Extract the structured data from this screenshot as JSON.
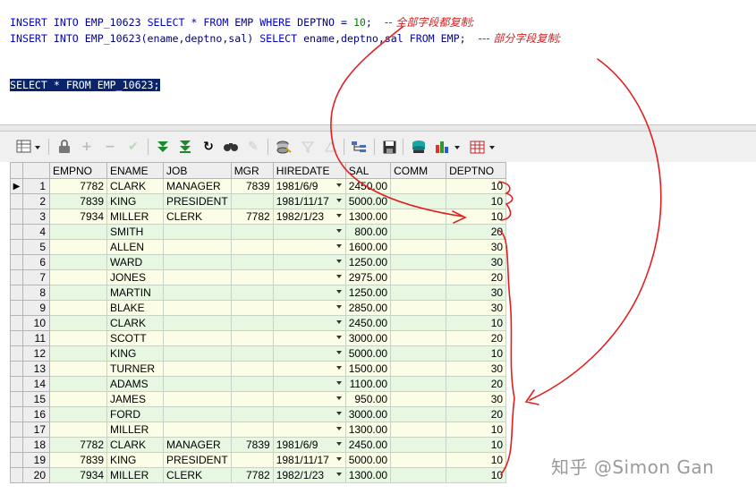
{
  "editor": {
    "line1": {
      "kw1": "INSERT INTO",
      "obj1": " EMP_10623 ",
      "kw2": "SELECT",
      "mid": " * ",
      "kw3": "FROM",
      "obj2": " EMP ",
      "kw4": "WHERE",
      "obj3": " DEPTNO = ",
      "num": "10",
      "tail": ";",
      "comment": "-- 全部字段都复制;"
    },
    "line2": {
      "kw1": "INSERT INTO",
      "obj1": " EMP_10623(ename,deptno,sal) ",
      "kw2": "SELECT",
      "obj2": " ename,deptno,sal ",
      "kw3": "FROM",
      "obj3": " EMP;",
      "comment": "--- 部分字段复制;"
    },
    "line3": {
      "text": "SELECT * FROM EMP_10623;"
    }
  },
  "toolbar": {
    "icons": [
      "grid-menu-icon",
      "lock-icon",
      "add-record-icon",
      "delete-record-icon",
      "post-check-icon",
      "fetch-next-icon",
      "fetch-last-icon",
      "refresh-icon",
      "find-icon",
      "clear-icon",
      "query-by-example-icon",
      "filter-icon",
      "clear-filter-icon",
      "explain-plan-icon",
      "save-icon",
      "export-icon",
      "chart-icon",
      "grid-view-icon"
    ]
  },
  "grid": {
    "columns": [
      "EMPNO",
      "ENAME",
      "JOB",
      "MGR",
      "HIREDATE",
      "SAL",
      "COMM",
      "DEPTNO"
    ],
    "rows": [
      {
        "n": "1",
        "empno": "7782",
        "ename": "CLARK",
        "job": "MANAGER",
        "mgr": "7839",
        "hiredate": "1981/6/9",
        "sal": "2450.00",
        "comm": "",
        "deptno": "10",
        "style": "y",
        "current": true
      },
      {
        "n": "2",
        "empno": "7839",
        "ename": "KING",
        "job": "PRESIDENT",
        "mgr": "",
        "hiredate": "1981/11/17",
        "sal": "5000.00",
        "comm": "",
        "deptno": "10",
        "style": "g"
      },
      {
        "n": "3",
        "empno": "7934",
        "ename": "MILLER",
        "job": "CLERK",
        "mgr": "7782",
        "hiredate": "1982/1/23",
        "sal": "1300.00",
        "comm": "",
        "deptno": "10",
        "style": "y"
      },
      {
        "n": "4",
        "empno": "",
        "ename": "SMITH",
        "job": "",
        "mgr": "",
        "hiredate": "",
        "sal": "800.00",
        "comm": "",
        "deptno": "20",
        "style": "g"
      },
      {
        "n": "5",
        "empno": "",
        "ename": "ALLEN",
        "job": "",
        "mgr": "",
        "hiredate": "",
        "sal": "1600.00",
        "comm": "",
        "deptno": "30",
        "style": "y"
      },
      {
        "n": "6",
        "empno": "",
        "ename": "WARD",
        "job": "",
        "mgr": "",
        "hiredate": "",
        "sal": "1250.00",
        "comm": "",
        "deptno": "30",
        "style": "g"
      },
      {
        "n": "7",
        "empno": "",
        "ename": "JONES",
        "job": "",
        "mgr": "",
        "hiredate": "",
        "sal": "2975.00",
        "comm": "",
        "deptno": "20",
        "style": "y"
      },
      {
        "n": "8",
        "empno": "",
        "ename": "MARTIN",
        "job": "",
        "mgr": "",
        "hiredate": "",
        "sal": "1250.00",
        "comm": "",
        "deptno": "30",
        "style": "g"
      },
      {
        "n": "9",
        "empno": "",
        "ename": "BLAKE",
        "job": "",
        "mgr": "",
        "hiredate": "",
        "sal": "2850.00",
        "comm": "",
        "deptno": "30",
        "style": "y"
      },
      {
        "n": "10",
        "empno": "",
        "ename": "CLARK",
        "job": "",
        "mgr": "",
        "hiredate": "",
        "sal": "2450.00",
        "comm": "",
        "deptno": "10",
        "style": "g"
      },
      {
        "n": "11",
        "empno": "",
        "ename": "SCOTT",
        "job": "",
        "mgr": "",
        "hiredate": "",
        "sal": "3000.00",
        "comm": "",
        "deptno": "20",
        "style": "y"
      },
      {
        "n": "12",
        "empno": "",
        "ename": "KING",
        "job": "",
        "mgr": "",
        "hiredate": "",
        "sal": "5000.00",
        "comm": "",
        "deptno": "10",
        "style": "g"
      },
      {
        "n": "13",
        "empno": "",
        "ename": "TURNER",
        "job": "",
        "mgr": "",
        "hiredate": "",
        "sal": "1500.00",
        "comm": "",
        "deptno": "30",
        "style": "y"
      },
      {
        "n": "14",
        "empno": "",
        "ename": "ADAMS",
        "job": "",
        "mgr": "",
        "hiredate": "",
        "sal": "1100.00",
        "comm": "",
        "deptno": "20",
        "style": "g"
      },
      {
        "n": "15",
        "empno": "",
        "ename": "JAMES",
        "job": "",
        "mgr": "",
        "hiredate": "",
        "sal": "950.00",
        "comm": "",
        "deptno": "30",
        "style": "y"
      },
      {
        "n": "16",
        "empno": "",
        "ename": "FORD",
        "job": "",
        "mgr": "",
        "hiredate": "",
        "sal": "3000.00",
        "comm": "",
        "deptno": "20",
        "style": "g"
      },
      {
        "n": "17",
        "empno": "",
        "ename": "MILLER",
        "job": "",
        "mgr": "",
        "hiredate": "",
        "sal": "1300.00",
        "comm": "",
        "deptno": "10",
        "style": "y"
      },
      {
        "n": "18",
        "empno": "7782",
        "ename": "CLARK",
        "job": "MANAGER",
        "mgr": "7839",
        "hiredate": "1981/6/9",
        "sal": "2450.00",
        "comm": "",
        "deptno": "10",
        "style": "g"
      },
      {
        "n": "19",
        "empno": "7839",
        "ename": "KING",
        "job": "PRESIDENT",
        "mgr": "",
        "hiredate": "1981/11/17",
        "sal": "5000.00",
        "comm": "",
        "deptno": "10",
        "style": "y"
      },
      {
        "n": "20",
        "empno": "7934",
        "ename": "MILLER",
        "job": "CLERK",
        "mgr": "7782",
        "hiredate": "1982/1/23",
        "sal": "1300.00",
        "comm": "",
        "deptno": "10",
        "style": "g"
      }
    ]
  },
  "watermark": "知乎 @Simon Gan",
  "colors": {
    "annotation": "#e02020",
    "keyword": "#0000cc",
    "selection": "#0a246a",
    "row_green": "#e7f7e2",
    "row_yellow": "#fbfde6"
  }
}
